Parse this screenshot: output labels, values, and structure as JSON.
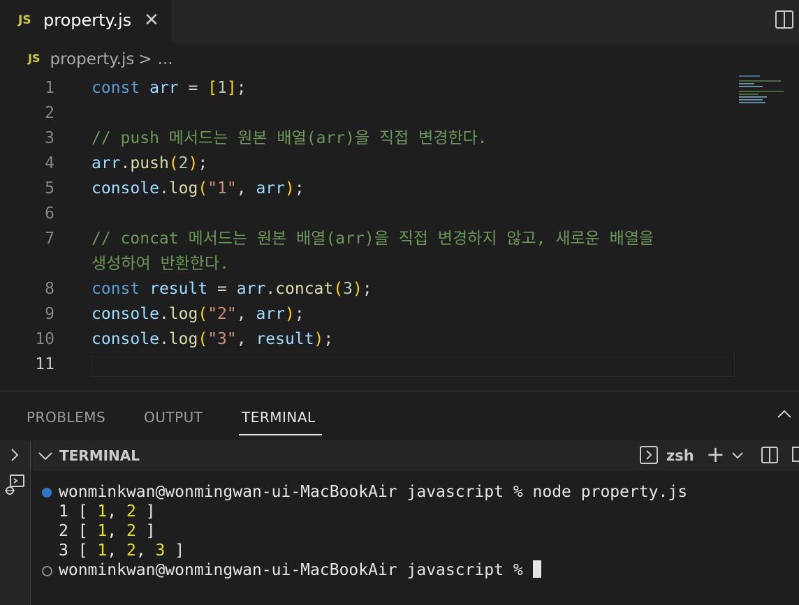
{
  "tab": {
    "icon": "JS",
    "title": "property.js",
    "close": "✕"
  },
  "breadcrumb": {
    "icon": "JS",
    "file": "property.js",
    "separator": ">",
    "rest": "..."
  },
  "editor": {
    "active_line": 11,
    "lines": [
      {
        "num": "1",
        "parts": [
          {
            "t": "const",
            "c": "kw"
          },
          {
            "t": " "
          },
          {
            "t": "arr",
            "c": "var"
          },
          {
            "t": " = "
          },
          {
            "t": "[",
            "c": "br1"
          },
          {
            "t": "1",
            "c": "num"
          },
          {
            "t": "]",
            "c": "br1"
          },
          {
            "t": ";"
          }
        ]
      },
      {
        "num": "2",
        "parts": []
      },
      {
        "num": "3",
        "parts": [
          {
            "t": "// push 메서드는 원본 배열(arr)을 직접 변경한다.",
            "c": "cmt"
          }
        ]
      },
      {
        "num": "4",
        "parts": [
          {
            "t": "arr",
            "c": "var"
          },
          {
            "t": "."
          },
          {
            "t": "push",
            "c": "fn"
          },
          {
            "t": "(",
            "c": "br1"
          },
          {
            "t": "2",
            "c": "num"
          },
          {
            "t": ")",
            "c": "br1"
          },
          {
            "t": ";"
          }
        ]
      },
      {
        "num": "5",
        "parts": [
          {
            "t": "console",
            "c": "var"
          },
          {
            "t": "."
          },
          {
            "t": "log",
            "c": "fn"
          },
          {
            "t": "(",
            "c": "br1"
          },
          {
            "t": "\"1\"",
            "c": "str"
          },
          {
            "t": ", "
          },
          {
            "t": "arr",
            "c": "var"
          },
          {
            "t": ")",
            "c": "br1"
          },
          {
            "t": ";"
          }
        ]
      },
      {
        "num": "6",
        "parts": []
      },
      {
        "num": "7",
        "parts": [
          {
            "t": "// concat 메서드는 원본 배열(arr)을 직접 변경하지 않고, 새로운 배열을",
            "c": "cmt"
          }
        ],
        "wrap": [
          {
            "t": "생성하여 반환한다.",
            "c": "cmt"
          }
        ]
      },
      {
        "num": "8",
        "parts": [
          {
            "t": "const",
            "c": "kw"
          },
          {
            "t": " "
          },
          {
            "t": "result",
            "c": "var"
          },
          {
            "t": " = "
          },
          {
            "t": "arr",
            "c": "var"
          },
          {
            "t": "."
          },
          {
            "t": "concat",
            "c": "fn"
          },
          {
            "t": "(",
            "c": "br1"
          },
          {
            "t": "3",
            "c": "num"
          },
          {
            "t": ")",
            "c": "br1"
          },
          {
            "t": ";"
          }
        ]
      },
      {
        "num": "9",
        "parts": [
          {
            "t": "console",
            "c": "var"
          },
          {
            "t": "."
          },
          {
            "t": "log",
            "c": "fn"
          },
          {
            "t": "(",
            "c": "br1"
          },
          {
            "t": "\"2\"",
            "c": "str"
          },
          {
            "t": ", "
          },
          {
            "t": "arr",
            "c": "var"
          },
          {
            "t": ")",
            "c": "br1"
          },
          {
            "t": ";"
          }
        ]
      },
      {
        "num": "10",
        "parts": [
          {
            "t": "console",
            "c": "var"
          },
          {
            "t": "."
          },
          {
            "t": "log",
            "c": "fn"
          },
          {
            "t": "(",
            "c": "br1"
          },
          {
            "t": "\"3\"",
            "c": "str"
          },
          {
            "t": ", "
          },
          {
            "t": "result",
            "c": "var"
          },
          {
            "t": ")",
            "c": "br1"
          },
          {
            "t": ";"
          }
        ]
      },
      {
        "num": "11",
        "parts": []
      }
    ]
  },
  "panel": {
    "tabs": [
      {
        "label": "PROBLEMS"
      },
      {
        "label": "OUTPUT"
      },
      {
        "label": "TERMINAL"
      }
    ],
    "active_tab": "TERMINAL",
    "terminal_header": "TERMINAL",
    "shell": "zsh"
  },
  "terminal": {
    "lines": [
      {
        "marker": "blue",
        "parts": [
          {
            "t": "wonminkwan@wonmingwan-ui-MacBookAir javascript % node property.js"
          }
        ]
      },
      {
        "marker": "none",
        "parts": [
          {
            "t": "1 [ "
          },
          {
            "t": "1",
            "c": "yl"
          },
          {
            "t": ", "
          },
          {
            "t": "2",
            "c": "yl"
          },
          {
            "t": " ]"
          }
        ]
      },
      {
        "marker": "none",
        "parts": [
          {
            "t": "2 [ "
          },
          {
            "t": "1",
            "c": "yl"
          },
          {
            "t": ", "
          },
          {
            "t": "2",
            "c": "yl"
          },
          {
            "t": " ]"
          }
        ]
      },
      {
        "marker": "none",
        "parts": [
          {
            "t": "3 [ "
          },
          {
            "t": "1",
            "c": "yl"
          },
          {
            "t": ", "
          },
          {
            "t": "2",
            "c": "yl"
          },
          {
            "t": ", "
          },
          {
            "t": "3",
            "c": "yl"
          },
          {
            "t": " ]"
          }
        ]
      },
      {
        "marker": "hollow",
        "parts": [
          {
            "t": "wonminkwan@wonmingwan-ui-MacBookAir javascript % "
          }
        ],
        "cursor": true
      }
    ]
  },
  "colors": {
    "background": "#1e1e1e",
    "keyword": "#569cd6",
    "variable": "#9cdcfe",
    "function": "#dcdcaa",
    "comment": "#6a9955",
    "string": "#ce9178",
    "number": "#b5cea8",
    "bracket": "#ffd700"
  }
}
